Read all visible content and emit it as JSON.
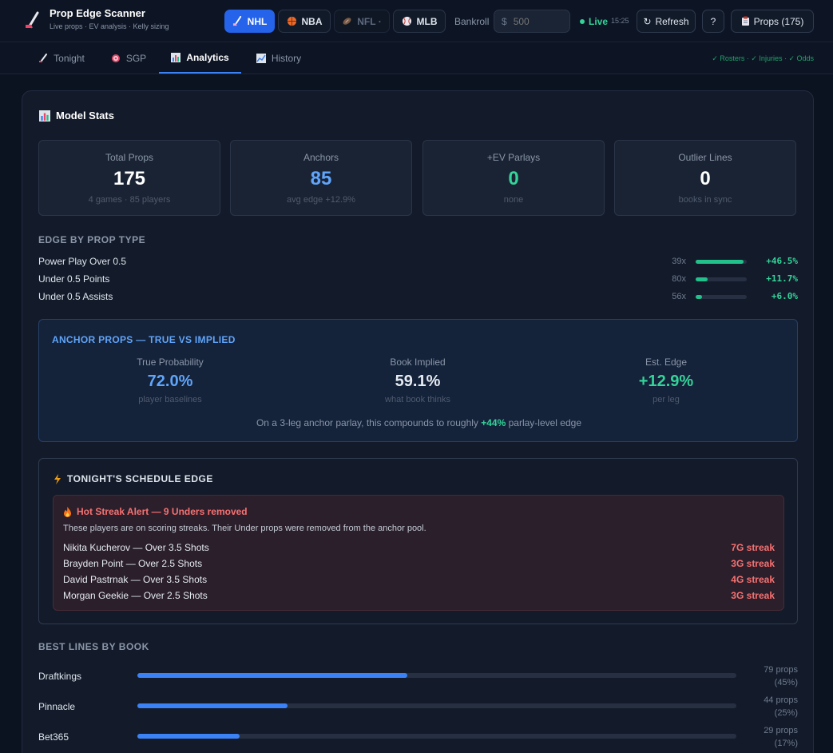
{
  "app": {
    "title": "Prop Edge Scanner",
    "subtitle": "Live props · EV analysis · Kelly sizing"
  },
  "sports": [
    {
      "label": "NHL",
      "icon": "hockey-icon",
      "state": "active"
    },
    {
      "label": "NBA",
      "icon": "basketball-icon",
      "state": "normal"
    },
    {
      "label": "NFL ·",
      "icon": "football-icon",
      "state": "disabled"
    },
    {
      "label": "MLB",
      "icon": "baseball-icon",
      "state": "normal"
    }
  ],
  "bankroll": {
    "label": "Bankroll",
    "currency": "$",
    "placeholder": "500"
  },
  "live": {
    "label": "Live",
    "time": "15:25"
  },
  "header_buttons": {
    "refresh": "Refresh",
    "help": "?",
    "props": "Props (175)"
  },
  "tabs": [
    {
      "label": "Tonight",
      "icon": "hockey-stick-icon",
      "active": false
    },
    {
      "label": "SGP",
      "icon": "target-icon",
      "active": false
    },
    {
      "label": "Analytics",
      "icon": "bar-chart-icon",
      "active": true
    },
    {
      "label": "History",
      "icon": "line-chart-icon",
      "active": false
    }
  ],
  "status_checks": "✓ Rosters  ·  ✓ Injuries  ·  ✓ Odds",
  "model_stats": {
    "title": "Model Stats",
    "cards": [
      {
        "label": "Total Props",
        "value": "175",
        "sub": "4 games · 85 players",
        "color": "#ffffff"
      },
      {
        "label": "Anchors",
        "value": "85",
        "sub": "avg edge +12.9%",
        "color": "#60a5fa"
      },
      {
        "label": "+EV Parlays",
        "value": "0",
        "sub": "none",
        "color": "#34d399"
      },
      {
        "label": "Outlier Lines",
        "value": "0",
        "sub": "books in sync",
        "color": "#ffffff"
      }
    ]
  },
  "edge_by_prop": {
    "title": "EDGE BY PROP TYPE",
    "rows": [
      {
        "name": "Power Play Over 0.5",
        "count": "39x",
        "fill_pct": 93,
        "edge": "+46.5%"
      },
      {
        "name": "Under 0.5 Points",
        "count": "80x",
        "fill_pct": 23,
        "edge": "+11.7%"
      },
      {
        "name": "Under 0.5 Assists",
        "count": "56x",
        "fill_pct": 12,
        "edge": "+6.0%"
      }
    ]
  },
  "anchor_props": {
    "title": "ANCHOR PROPS — TRUE VS IMPLIED",
    "cols": [
      {
        "label": "True Probability",
        "value": "72.0%",
        "sub": "player baselines",
        "color": "#60a5fa"
      },
      {
        "label": "Book Implied",
        "value": "59.1%",
        "sub": "what book thinks",
        "color": "#e6ebf2"
      },
      {
        "label": "Est. Edge",
        "value": "+12.9%",
        "sub": "per leg",
        "color": "#34d399"
      }
    ],
    "note_pre": "On a 3-leg anchor parlay, this compounds to roughly ",
    "note_highlight": "+44%",
    "note_post": " parlay-level edge"
  },
  "schedule_edge": {
    "title": "TONIGHT'S SCHEDULE EDGE",
    "alert_title": "Hot Streak Alert — 9 Unders removed",
    "alert_desc": "These players are on scoring streaks. Their Under props were removed from the anchor pool.",
    "streaks": [
      {
        "player": "Nikita Kucherov — Over 3.5 Shots",
        "streak": "7G streak"
      },
      {
        "player": "Brayden Point — Over 2.5 Shots",
        "streak": "3G streak"
      },
      {
        "player": "David Pastrnak — Over 3.5 Shots",
        "streak": "4G streak"
      },
      {
        "player": "Morgan Geekie — Over 2.5 Shots",
        "streak": "3G streak"
      }
    ]
  },
  "best_lines": {
    "title": "BEST LINES BY BOOK",
    "books": [
      {
        "name": "Draftkings",
        "props": "79 props",
        "pct": "(45%)",
        "fill_pct": 45
      },
      {
        "name": "Pinnacle",
        "props": "44 props",
        "pct": "(25%)",
        "fill_pct": 25
      },
      {
        "name": "Bet365",
        "props": "29 props",
        "pct": "(17%)",
        "fill_pct": 17
      }
    ]
  }
}
